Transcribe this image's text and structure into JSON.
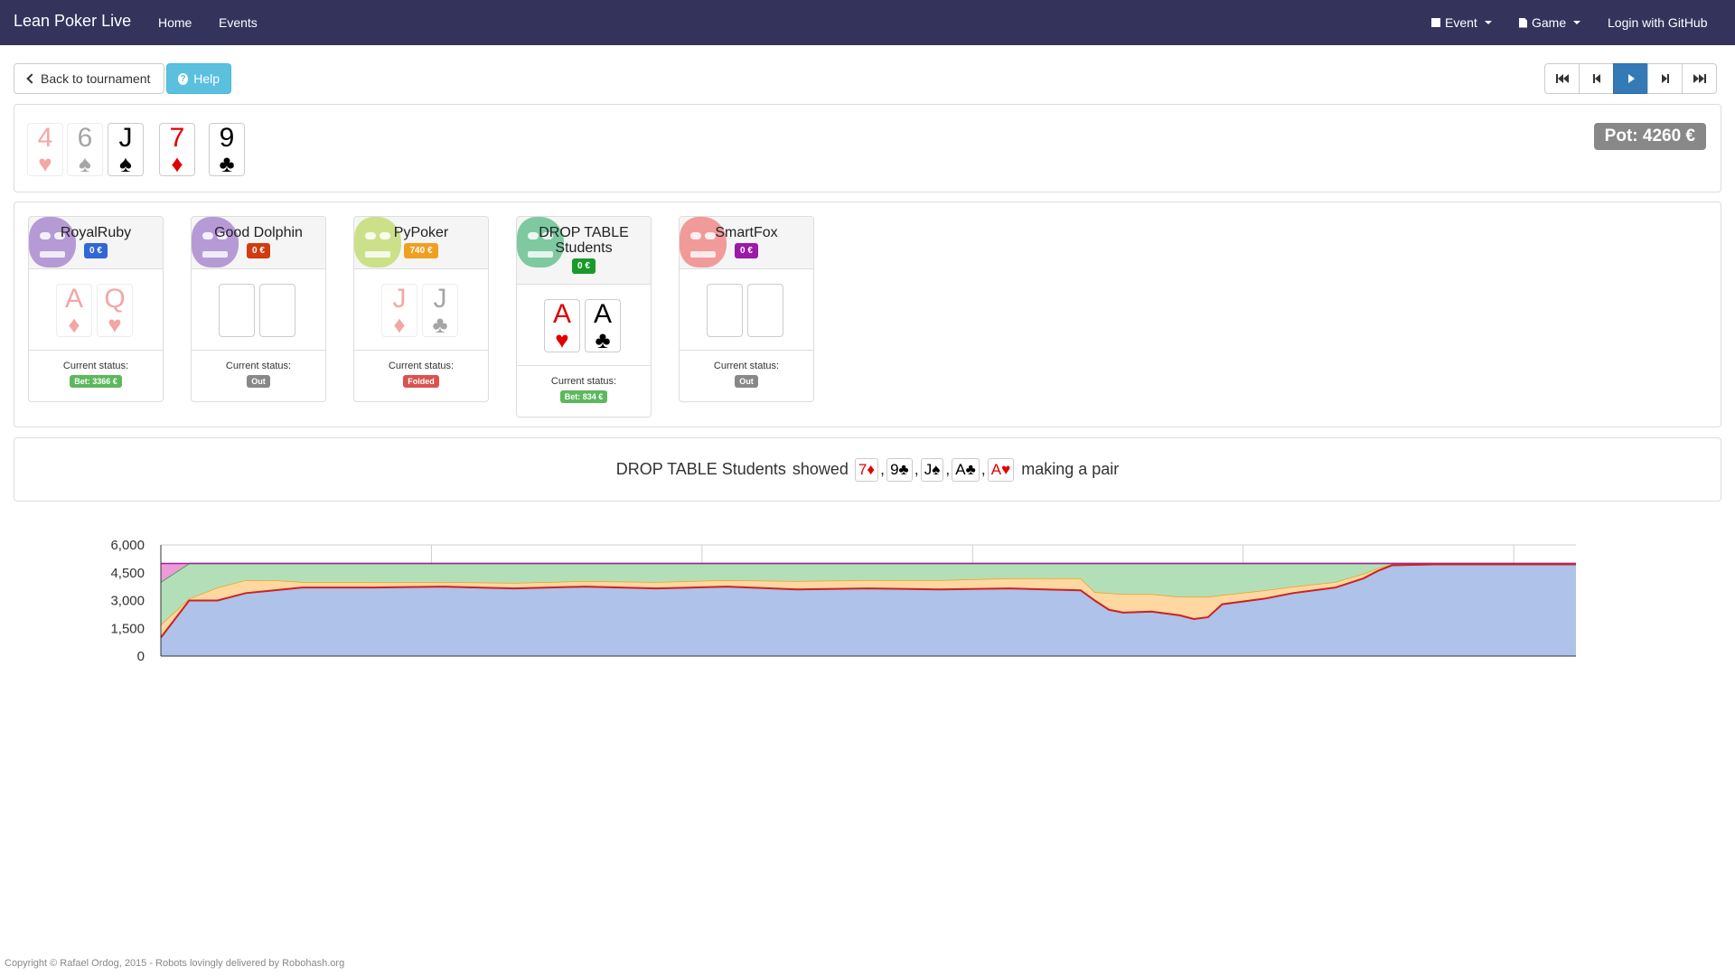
{
  "navbar": {
    "brand": "Lean Poker Live",
    "links": [
      "Home",
      "Events"
    ],
    "event_label": "Event",
    "game_label": "Game",
    "login_label": "Login with GitHub"
  },
  "toolbar": {
    "back_label": "Back to tournament",
    "help_label": "Help",
    "media_buttons": [
      "first-icon",
      "previous-icon",
      "play-icon",
      "next-icon",
      "last-icon"
    ]
  },
  "board": {
    "pot_label": "Pot: 4260 €",
    "cards": [
      {
        "rank": "4",
        "suit": "♥",
        "color": "red",
        "faded": true
      },
      {
        "rank": "6",
        "suit": "♠",
        "color": "black",
        "faded": true
      },
      {
        "rank": "J",
        "suit": "♠",
        "color": "black",
        "faded": false
      },
      {
        "rank": "7",
        "suit": "♦",
        "color": "red",
        "faded": false
      },
      {
        "rank": "9",
        "suit": "♣",
        "color": "black",
        "faded": false
      }
    ]
  },
  "players": [
    {
      "name": "RoyalRuby",
      "chips": "0 €",
      "chips_color": "#3367d6",
      "avatar_color": "#b59ad6",
      "cards": [
        {
          "rank": "A",
          "suit": "♦",
          "color": "red"
        },
        {
          "rank": "Q",
          "suit": "♥",
          "color": "red"
        }
      ],
      "cards_faded": true,
      "status_label": "Current status:",
      "status": "Bet: 3366 €",
      "status_color": "#5cb85c"
    },
    {
      "name": "Good Dolphin",
      "chips": "0 €",
      "chips_color": "#d03c0f",
      "avatar_color": "#b59ad6",
      "cards": [],
      "cards_faded": false,
      "status_label": "Current status:",
      "status": "Out",
      "status_color": "#888888"
    },
    {
      "name": "PyPoker",
      "chips": "740 €",
      "chips_color": "#f0a020",
      "avatar_color": "#cce08a",
      "cards": [
        {
          "rank": "J",
          "suit": "♦",
          "color": "red"
        },
        {
          "rank": "J",
          "suit": "♣",
          "color": "black"
        }
      ],
      "cards_faded": true,
      "status_label": "Current status:",
      "status": "Folded",
      "status_color": "#d9534f"
    },
    {
      "name": "DROP TABLE Students",
      "chips": "0 €",
      "chips_color": "#1a9a2a",
      "avatar_color": "#7fc9a0",
      "cards": [
        {
          "rank": "A",
          "suit": "♥",
          "color": "red"
        },
        {
          "rank": "A",
          "suit": "♣",
          "color": "black"
        }
      ],
      "cards_faded": false,
      "status_label": "Current status:",
      "status": "Bet: 834 €",
      "status_color": "#5cb85c"
    },
    {
      "name": "SmartFox",
      "chips": "0 €",
      "chips_color": "#9b1aa8",
      "avatar_color": "#f09a9a",
      "cards": [],
      "cards_faded": false,
      "status_label": "Current status:",
      "status": "Out",
      "status_color": "#888888"
    }
  ],
  "showdown": {
    "player": "DROP TABLE Students",
    "verb": "showed",
    "cards": [
      {
        "rank": "7",
        "suit": "♦",
        "color": "red"
      },
      {
        "rank": "9",
        "suit": "♣",
        "color": "black"
      },
      {
        "rank": "J",
        "suit": "♠",
        "color": "black"
      },
      {
        "rank": "A",
        "suit": "♣",
        "color": "black"
      },
      {
        "rank": "A",
        "suit": "♥",
        "color": "red"
      }
    ],
    "result": "making a pair"
  },
  "chart_data": {
    "type": "area",
    "stacked": true,
    "title": "",
    "xlabel": "",
    "ylabel": "",
    "ylim": [
      0,
      6000
    ],
    "yticks": [
      "0",
      "1,500",
      "3,000",
      "4,500",
      "6,000"
    ],
    "grid": true,
    "x": [
      0,
      2,
      4,
      6,
      8,
      10,
      15,
      20,
      25,
      30,
      35,
      40,
      45,
      50,
      55,
      60,
      65,
      66,
      67,
      68,
      70,
      72,
      73,
      74,
      75,
      78,
      80,
      83,
      85,
      86,
      87,
      90,
      95,
      100
    ],
    "series": [
      {
        "color": "#aec2ea",
        "values": [
          1000,
          3000,
          3000,
          3400,
          3550,
          3700,
          3700,
          3750,
          3650,
          3750,
          3650,
          3750,
          3600,
          3650,
          3600,
          3650,
          3550,
          3000,
          2500,
          2350,
          2400,
          2200,
          2000,
          2100,
          2800,
          3100,
          3400,
          3700,
          4200,
          4600,
          4900,
          4950,
          4950,
          4950
        ]
      },
      {
        "color": "#ffd7a0",
        "values": [
          700,
          100,
          700,
          700,
          550,
          300,
          300,
          250,
          300,
          300,
          350,
          350,
          450,
          450,
          500,
          550,
          650,
          450,
          900,
          1000,
          950,
          1000,
          1200,
          1100,
          500,
          450,
          350,
          300,
          250,
          150,
          50,
          0,
          0,
          0
        ]
      },
      {
        "color": "#b3dfb8",
        "values": [
          2300,
          1900,
          1300,
          900,
          900,
          1000,
          1000,
          1000,
          1050,
          950,
          1000,
          900,
          950,
          900,
          900,
          800,
          800,
          1550,
          1600,
          1650,
          1650,
          1800,
          1800,
          1800,
          1700,
          1450,
          1250,
          1000,
          550,
          250,
          50,
          50,
          50,
          50
        ]
      },
      {
        "color": "#ea9bd8",
        "values": [
          1000,
          0,
          0,
          0,
          0,
          0,
          0,
          0,
          0,
          0,
          0,
          0,
          0,
          0,
          0,
          0,
          0,
          0,
          0,
          0,
          0,
          0,
          0,
          0,
          0,
          0,
          0,
          0,
          0,
          0,
          0,
          0,
          0,
          0
        ]
      }
    ]
  },
  "footer": {
    "text": "Copyright © Rafael Ordog, 2015 - Robots lovingly delivered by Robohash.org"
  }
}
